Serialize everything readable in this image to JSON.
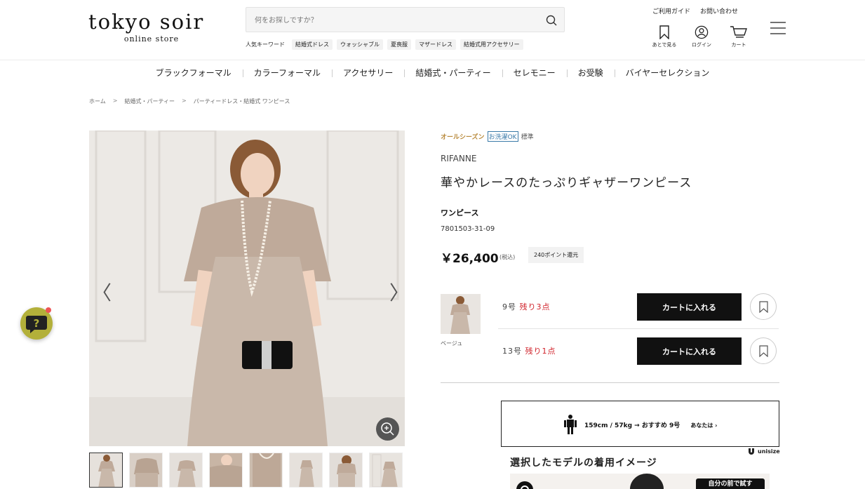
{
  "header": {
    "logo_main": "tokyo soir",
    "logo_sub": "online store",
    "search_placeholder": "何をお探しですか？",
    "keywords_label": "人気キーワード",
    "keywords": [
      "結婚式ドレス",
      "ウォッシャブル",
      "夏喪服",
      "マザードレス",
      "結婚式用アクセサリー"
    ],
    "util_links": [
      "ご利用ガイド",
      "お問い合わせ"
    ],
    "icons": [
      {
        "name": "bookmark-icon",
        "label": "あとで見る"
      },
      {
        "name": "user-icon",
        "label": "ログイン"
      },
      {
        "name": "cart-icon",
        "label": "カート"
      }
    ]
  },
  "nav": [
    "ブラックフォーマル",
    "カラーフォーマル",
    "アクセサリー",
    "結婚式・パーティー",
    "セレモニー",
    "お受験",
    "バイヤーセレクション"
  ],
  "breadcrumb": [
    "ホーム",
    "結婚式・パーティー",
    "パーティードレス・結婚式 ワンピース"
  ],
  "breadcrumb_sep": ">",
  "gallery": {
    "prev": "〈",
    "next": "〉",
    "thumb_count": 8
  },
  "product": {
    "tags": [
      "オールシーズン",
      "お洗濯OK",
      "標準"
    ],
    "brand": "RIFANNE",
    "name": "華やかレースのたっぷりギャザーワンピース",
    "category": "ワンピース",
    "sku": "7801503-31-09",
    "price": "￥26,400",
    "tax": "(税込)",
    "points": "240ポイント還元",
    "color": "ベージュ",
    "sizes": [
      {
        "size": "9号",
        "stock": "残り3点",
        "cart_label": "カートに入れる"
      },
      {
        "size": "13号",
        "stock": "残り1点",
        "cart_label": "カートに入れる"
      }
    ]
  },
  "unisize": {
    "recommend": "159cm / 57kg → おすすめ 9号",
    "you": "あなたは ›",
    "logo": "unisize"
  },
  "model": {
    "heading": "選択したモデルの着用イメージ",
    "button": "自分の前で試す"
  },
  "colors": {
    "accent_gold": "#b8893a",
    "wash_blue": "#3a7aa8",
    "stock_red": "#d0222a",
    "cart_black": "#111111",
    "help_bubble": "#b3b03a"
  }
}
